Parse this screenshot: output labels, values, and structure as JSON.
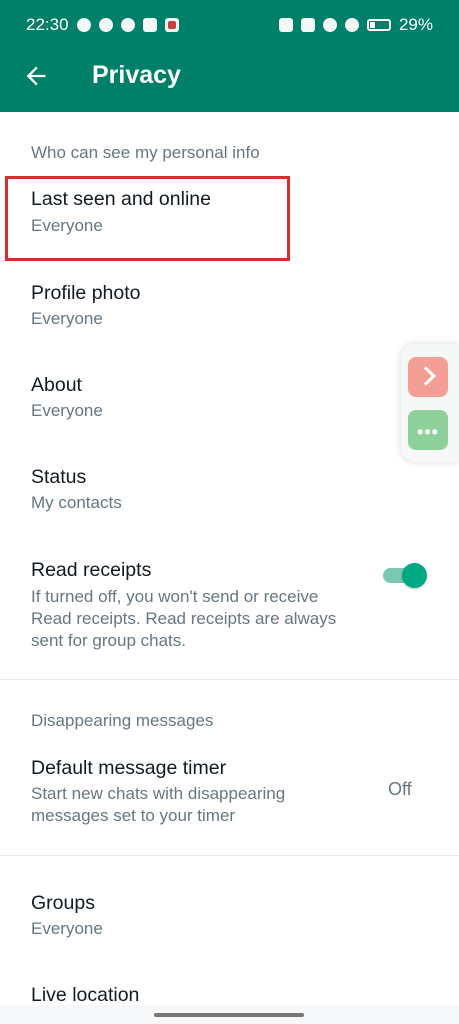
{
  "status_bar": {
    "time": "22:30",
    "battery": "29%"
  },
  "toolbar": {
    "title": "Privacy",
    "back_icon": "arrow-left-icon"
  },
  "personal_info": {
    "header": "Who can see my personal info",
    "items": [
      {
        "title": "Last seen and online",
        "subtitle": "Everyone"
      },
      {
        "title": "Profile photo",
        "subtitle": "Everyone"
      },
      {
        "title": "About",
        "subtitle": "Everyone"
      },
      {
        "title": "Status",
        "subtitle": "My contacts"
      }
    ],
    "read_receipts": {
      "title": "Read receipts",
      "description_lines": [
        "If turned off, you won't send or receive",
        "Read receipts. Read receipts are always",
        "sent for group chats."
      ],
      "enabled": true
    }
  },
  "disappearing": {
    "header": "Disappearing messages",
    "timer": {
      "title": "Default message timer",
      "description_lines": [
        "Start new chats with disappearing",
        "messages set to your timer"
      ],
      "value": "Off"
    }
  },
  "more": {
    "groups": {
      "title": "Groups",
      "subtitle": "Everyone"
    },
    "live_location": {
      "title": "Live location"
    }
  },
  "colors": {
    "header_bg": "#008069",
    "accent": "#00a884",
    "highlight_border": "#d32f2f"
  }
}
